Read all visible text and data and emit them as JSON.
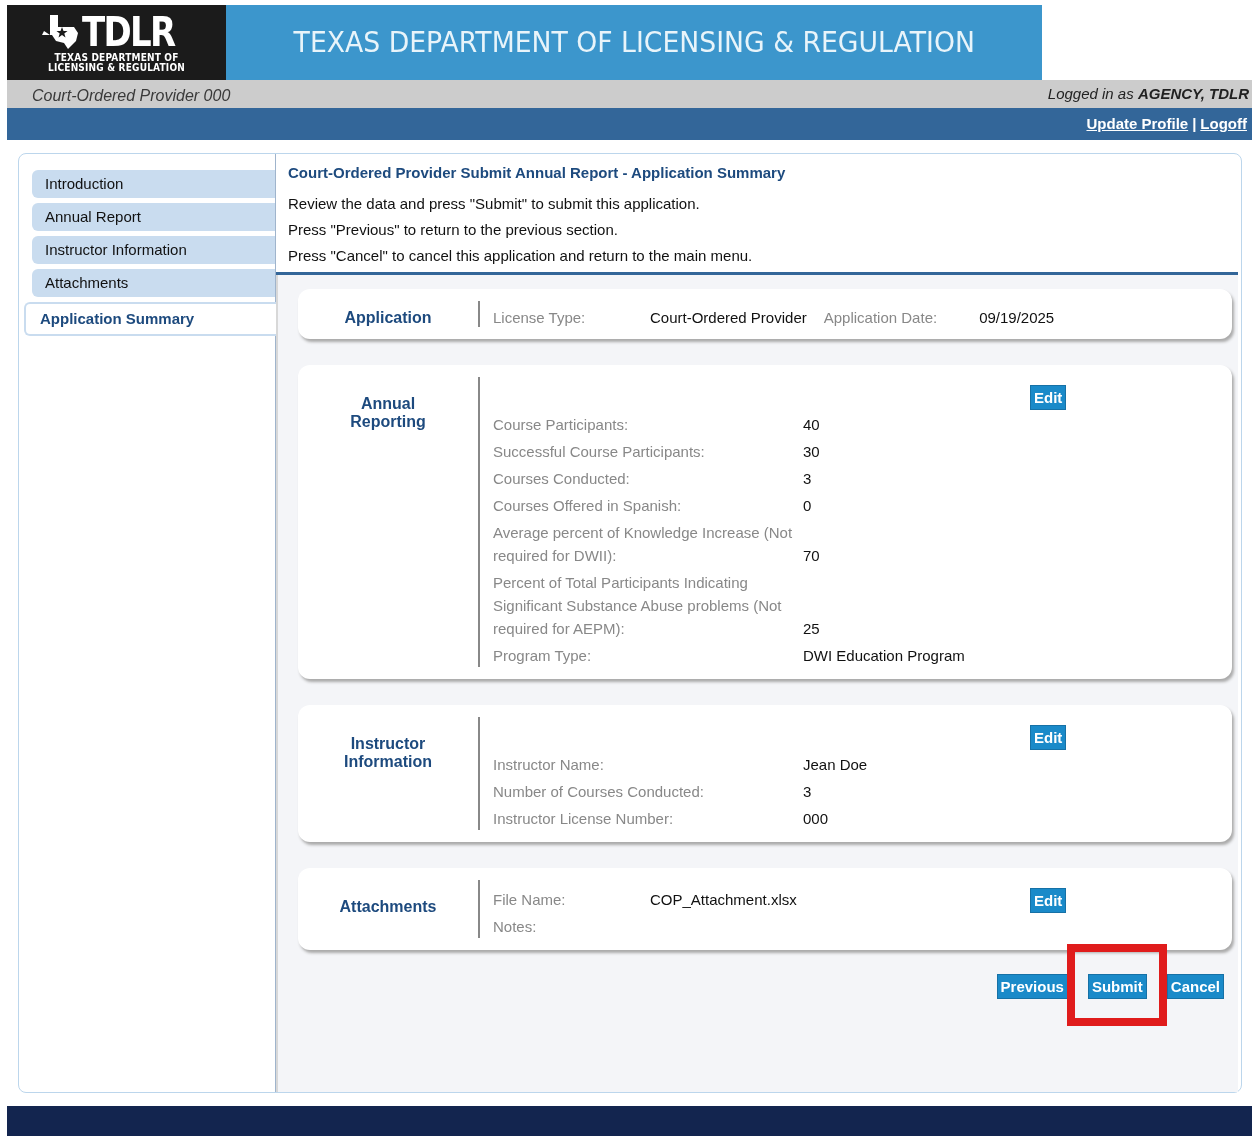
{
  "header": {
    "logo": {
      "wordmark": "TDLR",
      "subtitle": [
        "TEXAS DEPARTMENT OF",
        "LICENSING & REGULATION"
      ]
    },
    "title": "TEXAS DEPARTMENT OF LICENSING & REGULATION",
    "program": "Court-Ordered Provider 000",
    "logged_in": {
      "prefix": "Logged in as",
      "user": "AGENCY, TDLR"
    },
    "links": [
      "Update Profile",
      "Logoff"
    ],
    "separator": "|"
  },
  "sidebar": {
    "items": [
      {
        "label": "Introduction",
        "selected": false
      },
      {
        "label": "Annual Report",
        "selected": false
      },
      {
        "label": "Instructor Information",
        "selected": false
      },
      {
        "label": "Attachments",
        "selected": false
      },
      {
        "label": "Application Summary",
        "selected": true
      }
    ]
  },
  "intro": {
    "title": "Court-Ordered Provider Submit Annual Report - Application Summary",
    "lines": [
      "Review the data and press \"Submit\" to submit this application.",
      "Press \"Previous\" to return to the previous section.",
      "Press \"Cancel\" to cancel this application and return to the main menu."
    ]
  },
  "sections": [
    {
      "title": "Application",
      "kind": "inline",
      "fields": [
        {
          "label": "License Type:",
          "value": "Court-Ordered Provider"
        },
        {
          "label": "Application Date:",
          "value": "09/19/2025"
        }
      ]
    },
    {
      "title": "Annual Reporting",
      "kind": "list",
      "edit": "Edit",
      "fields": [
        {
          "label": "Course Participants:",
          "value": "40"
        },
        {
          "label": "Successful Course Participants:",
          "value": "30"
        },
        {
          "label": "Courses Conducted:",
          "value": "3"
        },
        {
          "label": "Courses Offered in Spanish:",
          "value": "0"
        },
        {
          "label": "Average percent of Knowledge Increase (Not required for DWII):",
          "value": "70"
        },
        {
          "label": "Percent of Total Participants Indicating Significant Substance Abuse problems (Not required for AEPM):",
          "value": "25"
        },
        {
          "label": "Program Type:",
          "value": "DWI Education Program"
        }
      ]
    },
    {
      "title": "Instructor Information",
      "kind": "list",
      "edit": "Edit",
      "fields": [
        {
          "label": "Instructor Name:",
          "value": "Jean Doe"
        },
        {
          "label": "Number of Courses Conducted:",
          "value": "3"
        },
        {
          "label": "Instructor License Number:",
          "value": "000"
        }
      ]
    },
    {
      "title": "Attachments",
      "kind": "pairs",
      "edit": "Edit",
      "fields": [
        {
          "label": "File Name:",
          "value": "COP_Attachment.xlsx"
        },
        {
          "label": "Notes:"
        }
      ]
    }
  ],
  "buttons": [
    {
      "label": "Previous",
      "highlighted": false
    },
    {
      "label": "Submit",
      "highlighted": true
    },
    {
      "label": "Cancel",
      "highlighted": false
    }
  ]
}
